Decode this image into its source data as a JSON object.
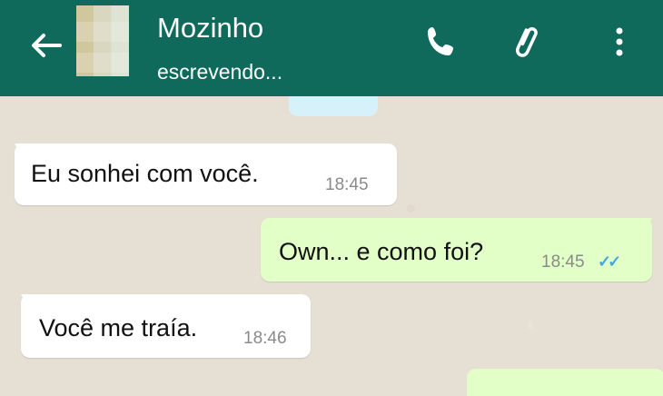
{
  "header": {
    "contact_name": "Mozinho",
    "status": "escrevendo...",
    "background": "#0f6a5c",
    "icons": [
      "back-arrow-icon",
      "avatar",
      "phone-icon",
      "paperclip-icon",
      "more-vertical-icon"
    ]
  },
  "messages": [
    {
      "direction": "incoming",
      "text": "Eu sonhei com você.",
      "time": "18:45"
    },
    {
      "direction": "outgoing",
      "text": "Own... e como foi?",
      "time": "18:45",
      "status": "read"
    },
    {
      "direction": "incoming",
      "text": "Você me traía.",
      "time": "18:46"
    }
  ],
  "colors": {
    "chat_background": "#e6dfd4",
    "incoming_bubble": "#ffffff",
    "outgoing_bubble": "#e2ffc7",
    "read_ticks": "#47a7df"
  }
}
